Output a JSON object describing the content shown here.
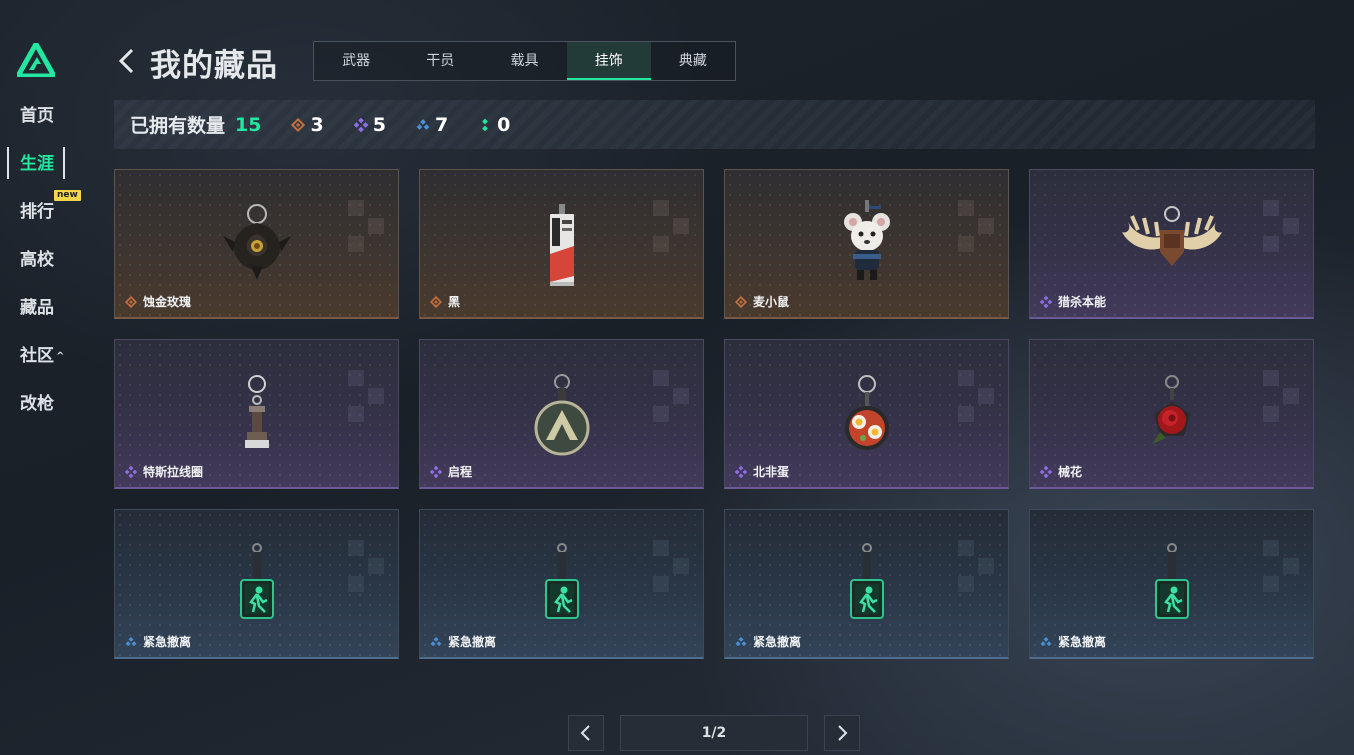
{
  "sidebar": {
    "items": [
      {
        "label": "首页"
      },
      {
        "label": "生涯",
        "active": true
      },
      {
        "label": "排行",
        "badge": "new"
      },
      {
        "label": "高校"
      },
      {
        "label": "藏品"
      },
      {
        "label": "社区",
        "caret": "^"
      },
      {
        "label": "改枪"
      }
    ]
  },
  "header": {
    "title": "我的藏品",
    "tabs": [
      {
        "label": "武器"
      },
      {
        "label": "干员"
      },
      {
        "label": "载具"
      },
      {
        "label": "挂饰",
        "active": true
      },
      {
        "label": "典藏"
      }
    ]
  },
  "stats": {
    "owned_label": "已拥有数量",
    "owned_count": "15",
    "tiers": [
      {
        "rarity": "orange",
        "count": "3"
      },
      {
        "rarity": "purple",
        "count": "5"
      },
      {
        "rarity": "blue",
        "count": "7"
      },
      {
        "rarity": "green",
        "count": "0"
      }
    ]
  },
  "items": [
    {
      "name": "蚀金玫瑰",
      "rarity": "orange",
      "icon": "black-rose-charm"
    },
    {
      "name": "黑",
      "rarity": "orange",
      "icon": "card-tag-charm"
    },
    {
      "name": "麦小鼠",
      "rarity": "orange",
      "icon": "mouse-figure-charm"
    },
    {
      "name": "猎杀本能",
      "rarity": "purple",
      "icon": "antler-trophy-charm"
    },
    {
      "name": "特斯拉线圈",
      "rarity": "purple",
      "icon": "tesla-coil-charm"
    },
    {
      "name": "启程",
      "rarity": "purple",
      "icon": "round-medal-charm"
    },
    {
      "name": "北非蛋",
      "rarity": "purple",
      "icon": "shakshuka-pan-charm"
    },
    {
      "name": "械花",
      "rarity": "purple",
      "icon": "red-rose-charm"
    },
    {
      "name": "紧急撤离",
      "rarity": "blue",
      "icon": "exit-sign-charm"
    },
    {
      "name": "紧急撤离",
      "rarity": "blue",
      "icon": "exit-sign-charm"
    },
    {
      "name": "紧急撤离",
      "rarity": "blue",
      "icon": "exit-sign-charm"
    },
    {
      "name": "紧急撤离",
      "rarity": "blue",
      "icon": "exit-sign-charm"
    }
  ],
  "pagination": {
    "label": "1/2"
  },
  "colors": {
    "accent": "#23e6a0",
    "orange": "#c4703e",
    "purple": "#8d6ee0",
    "blue": "#4a8fd6",
    "green": "#23e6a0"
  }
}
